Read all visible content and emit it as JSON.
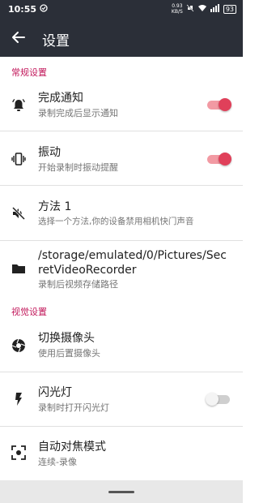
{
  "status_bar": {
    "time": "10:55",
    "speed_value": "0.93",
    "speed_unit": "KB/S",
    "battery": "93"
  },
  "app_bar": {
    "title": "设置"
  },
  "sections": [
    {
      "header": "常规设置",
      "items": [
        {
          "title": "完成通知",
          "subtitle": "录制完成后显示通知",
          "icon": "bell-icon",
          "toggle": true
        },
        {
          "title": "振动",
          "subtitle": "开始录制时振动提醒",
          "icon": "vibrate-icon",
          "toggle": true
        },
        {
          "title": "方法 1",
          "subtitle": "选择一个方法,你的设备禁用相机快门声音",
          "icon": "volume-off-icon"
        },
        {
          "title": "/storage/emulated/0/Pictures/SecretVideoRecorder",
          "subtitle": "录制后视频存储路径",
          "icon": "folder-icon"
        }
      ]
    },
    {
      "header": "视觉设置",
      "items": [
        {
          "title": "切换摄像头",
          "subtitle": "使用后置摄像头",
          "icon": "camera-switch-icon"
        },
        {
          "title": "闪光灯",
          "subtitle": "录制时打开闪光灯",
          "icon": "flash-icon",
          "toggle": false
        },
        {
          "title": "自动对焦模式",
          "subtitle": "连续-录像",
          "icon": "autofocus-icon"
        }
      ]
    }
  ],
  "colors": {
    "app_bar": "#2b2f38",
    "accent": "#e0405a",
    "section_header": "#c2185b"
  }
}
